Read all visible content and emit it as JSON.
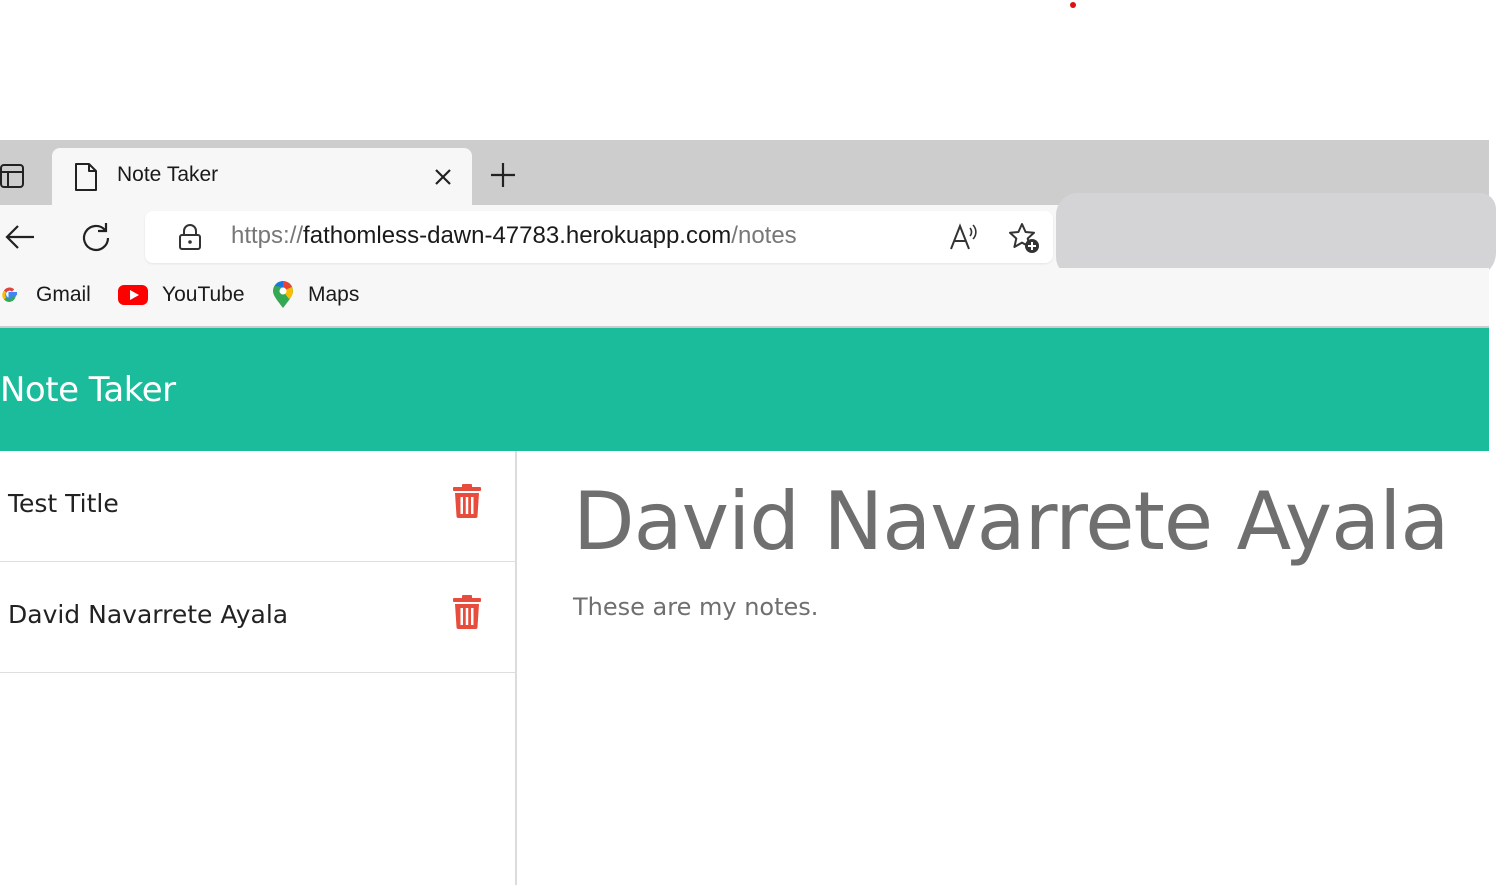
{
  "browser": {
    "tab_title": "Note Taker",
    "url_scheme": "https://",
    "url_host": "fathomless-dawn-47783.herokuapp.com",
    "url_path": "/notes",
    "bookmarks": [
      {
        "label": "Gmail",
        "icon": "google-icon"
      },
      {
        "label": "YouTube",
        "icon": "youtube-icon"
      },
      {
        "label": "Maps",
        "icon": "maps-icon"
      }
    ]
  },
  "app": {
    "title": "Note Taker",
    "accent_color": "#1abc9c",
    "delete_color": "#e74c3c",
    "notes": [
      {
        "title": "Test Title"
      },
      {
        "title": "David Navarrete Ayala"
      }
    ],
    "active_note": {
      "title": "David Navarrete Ayala",
      "text": "These are my notes."
    }
  }
}
